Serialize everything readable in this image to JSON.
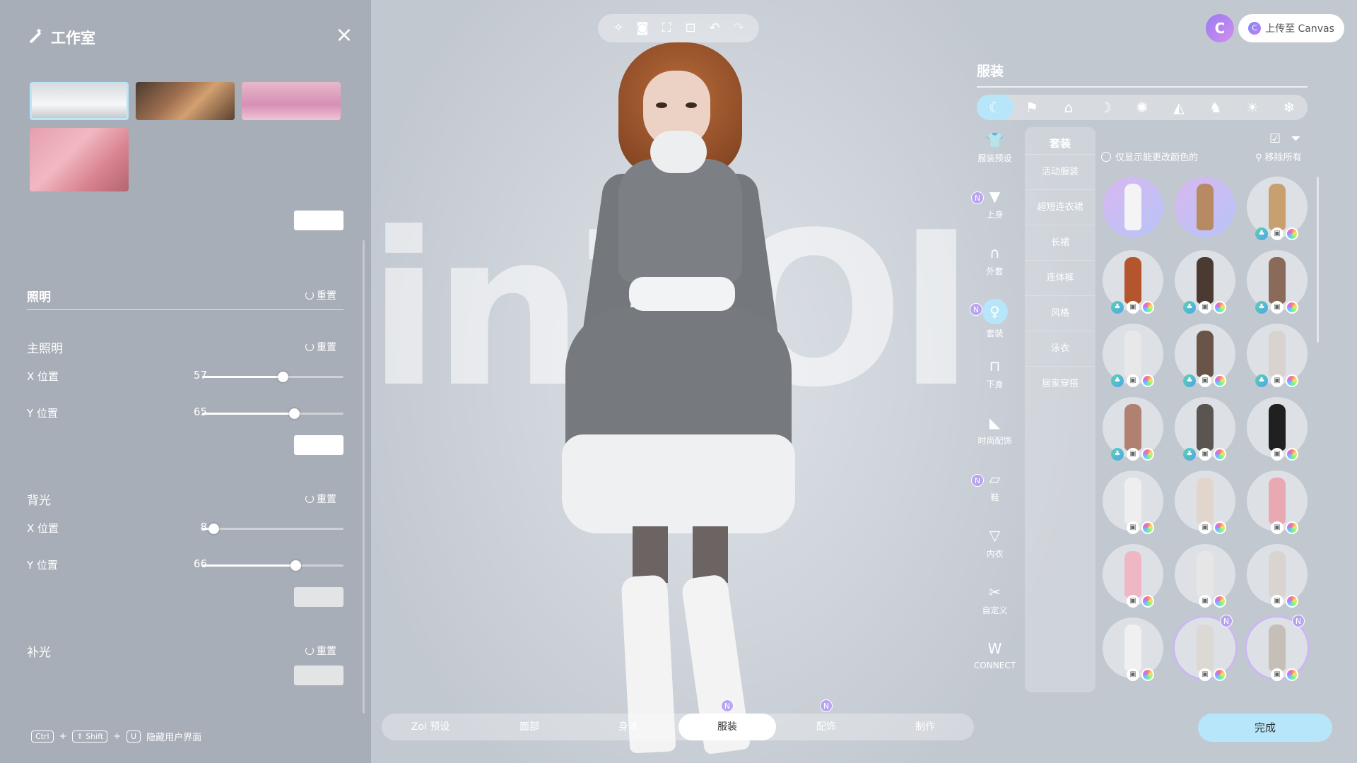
{
  "studio": {
    "title": "工作室",
    "close_icon": "×",
    "lighting": {
      "title": "照明",
      "reset_label": "重置",
      "main_light": {
        "title": "主照明",
        "reset_label": "重置",
        "x": {
          "label": "X 位置",
          "value": 57
        },
        "y": {
          "label": "Y 位置",
          "value": 65
        }
      },
      "back_light": {
        "title": "背光",
        "reset_label": "重置",
        "x": {
          "label": "X 位置",
          "value": 8
        },
        "y": {
          "label": "Y 位置",
          "value": 66
        }
      },
      "fill_light": {
        "title": "补光",
        "reset_label": "重置"
      }
    },
    "shortcut": {
      "keys": [
        "Ctrl",
        "⇑ Shift",
        "U"
      ],
      "plus": "+",
      "label": "隐藏用户界面"
    }
  },
  "toolbar": {
    "icons": [
      "sparkle-icon",
      "camera-icon",
      "focus-icon",
      "face-focus-icon",
      "undo-icon",
      "redo-icon"
    ]
  },
  "top_right": {
    "avatar_letter": "C",
    "canvas_logo": "C",
    "upload_label": "上传至 Canvas"
  },
  "outfit": {
    "title": "服装",
    "categories": [
      "all-icon",
      "gift-icon",
      "graduation-icon",
      "moon-icon",
      "party-icon",
      "sneaker-icon",
      "horse-icon",
      "sun-icon",
      "snow-icon"
    ],
    "nav": [
      {
        "label": "服装预设",
        "icon": "preset-icon",
        "badge": ""
      },
      {
        "label": "上身",
        "icon": "shirt-icon",
        "badge": "N"
      },
      {
        "label": "外套",
        "icon": "coat-icon",
        "badge": ""
      },
      {
        "label": "套装",
        "icon": "dress-icon",
        "badge": "N"
      },
      {
        "label": "下身",
        "icon": "pants-icon",
        "badge": ""
      },
      {
        "label": "时尚配饰",
        "icon": "boot-icon",
        "badge": ""
      },
      {
        "label": "鞋",
        "icon": "shoe-icon",
        "badge": "N"
      },
      {
        "label": "内衣",
        "icon": "underwear-icon",
        "badge": ""
      },
      {
        "label": "自定义",
        "icon": "scissors-icon",
        "badge": ""
      },
      {
        "label": "CONNECT",
        "icon": "connect-icon",
        "badge": ""
      }
    ],
    "sub_title": "套装",
    "sub_items": [
      "活动服装",
      "超短连衣裙",
      "长裙",
      "连体裤",
      "风格",
      "泳衣",
      "居家穿搭"
    ],
    "filter_label": "仅显示能更改颜色的",
    "remove_all_label": "移除所有",
    "badge_n": "N",
    "items": [
      {
        "fig": "#f4f4f6",
        "purple": true,
        "palm": false,
        "ph": false,
        "color": false,
        "n": false
      },
      {
        "fig": "#b88a64",
        "purple": true,
        "palm": false,
        "ph": false,
        "color": false,
        "n": false
      },
      {
        "fig": "#c8a070",
        "purple": false,
        "palm": true,
        "ph": true,
        "color": true,
        "n": false
      },
      {
        "fig": "#b5552e",
        "purple": false,
        "palm": true,
        "ph": true,
        "color": true,
        "n": false
      },
      {
        "fig": "#4a3a32",
        "purple": false,
        "palm": true,
        "ph": true,
        "color": true,
        "n": false
      },
      {
        "fig": "#8a6a58",
        "purple": false,
        "palm": true,
        "ph": true,
        "color": true,
        "n": false
      },
      {
        "fig": "#e8e8ea",
        "purple": false,
        "palm": true,
        "ph": true,
        "color": true,
        "n": false
      },
      {
        "fig": "#6a5448",
        "purple": false,
        "palm": true,
        "ph": true,
        "color": true,
        "n": false
      },
      {
        "fig": "#d9d3d0",
        "purple": false,
        "palm": true,
        "ph": true,
        "color": true,
        "n": false
      },
      {
        "fig": "#b08070",
        "purple": false,
        "palm": true,
        "ph": true,
        "color": true,
        "n": false
      },
      {
        "fig": "#5b5551",
        "purple": false,
        "palm": true,
        "ph": true,
        "color": true,
        "n": false
      },
      {
        "fig": "#202020",
        "purple": false,
        "palm": false,
        "ph": true,
        "color": true,
        "n": false
      },
      {
        "fig": "#eeeeee",
        "purple": false,
        "palm": false,
        "ph": true,
        "color": true,
        "n": false
      },
      {
        "fig": "#e2d6cc",
        "purple": false,
        "palm": false,
        "ph": true,
        "color": true,
        "n": false
      },
      {
        "fig": "#e8a9b3",
        "purple": false,
        "palm": false,
        "ph": true,
        "color": true,
        "n": false
      },
      {
        "fig": "#efb6c4",
        "purple": false,
        "palm": false,
        "ph": true,
        "color": true,
        "n": false
      },
      {
        "fig": "#e6e6e6",
        "purple": false,
        "palm": false,
        "ph": true,
        "color": true,
        "n": false
      },
      {
        "fig": "#d9d4cf",
        "purple": false,
        "palm": false,
        "ph": true,
        "color": true,
        "n": false
      },
      {
        "fig": "#f0f0f0",
        "purple": false,
        "palm": false,
        "ph": true,
        "color": true,
        "n": false
      },
      {
        "fig": "#dcd8d4",
        "purple": false,
        "palm": false,
        "ph": true,
        "color": true,
        "n": true
      },
      {
        "fig": "#c6bfb8",
        "purple": false,
        "palm": false,
        "ph": true,
        "color": true,
        "n": true
      }
    ]
  },
  "tabs": {
    "items": [
      {
        "label": "Zoi 预设",
        "badge": ""
      },
      {
        "label": "面部",
        "badge": ""
      },
      {
        "label": "身体",
        "badge": ""
      },
      {
        "label": "服装",
        "badge": "N"
      },
      {
        "label": "配饰",
        "badge": "N"
      },
      {
        "label": "制作",
        "badge": ""
      }
    ],
    "active_index": 3
  },
  "done_label": "完成",
  "watermark": "inZOI",
  "colors": {
    "accent": "#b7e6fb",
    "badge_purple": "#b9a4f2"
  }
}
